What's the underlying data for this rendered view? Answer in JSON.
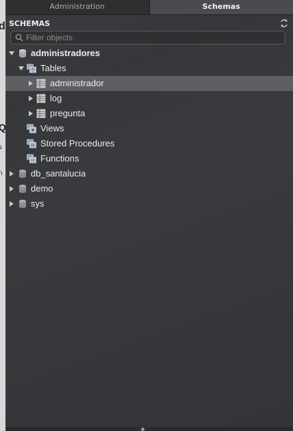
{
  "tabs": [
    {
      "label": "Administration"
    },
    {
      "label": "Schemas"
    }
  ],
  "header": {
    "title": "SCHEMAS"
  },
  "filter": {
    "placeholder": "Filter objects"
  },
  "tree": {
    "schema_admin": {
      "label": "administradores"
    },
    "tables": {
      "label": "Tables"
    },
    "table_items": [
      {
        "label": "administrador"
      },
      {
        "label": "log"
      },
      {
        "label": "pregunta"
      }
    ],
    "views": {
      "label": "Views"
    },
    "procedures": {
      "label": "Stored Procedures"
    },
    "functions": {
      "label": "Functions"
    },
    "other_schemas": [
      {
        "label": "db_santalucia"
      },
      {
        "label": "demo"
      },
      {
        "label": "sys"
      }
    ]
  },
  "colors": {
    "panel_bg": "#38393c",
    "selected_row": "#5e5f62",
    "text": "#ececec"
  }
}
